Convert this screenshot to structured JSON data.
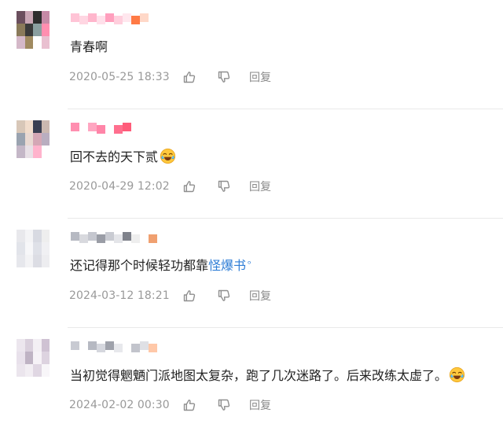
{
  "comments": [
    {
      "text": "青春啊",
      "time": "2020-05-25 18:33",
      "reply_label": "回复",
      "avatar_colors": [
        "#6b4f5e",
        "#c9a6b5",
        "#2d2d2d",
        "#c58aa6",
        "#8a7a5a",
        "#3a3a3a",
        "#8a9fa0",
        "#ff8fb0",
        "#d4b8c8",
        "#a08a60",
        "#ffffff",
        "#e9c0d0"
      ],
      "name_colors": [
        "#ffc4d6",
        "#ffd6e2",
        "#ffb6cc",
        "#ffe0ea",
        "#ff9fbd",
        "#ffcfdd",
        "#ffe7ee",
        "#ff7a45",
        "#ffd8c8"
      ]
    },
    {
      "text": "回不去的天下贰",
      "emoji": "crying-laughing-emoji",
      "time": "2020-04-29 12:02",
      "reply_label": "回复",
      "avatar_colors": [
        "#d8c7b8",
        "#f1dccb",
        "#3a3f52",
        "#cbb8b0",
        "#9aa3b0",
        "#e9d9d2",
        "#d4a7b5",
        "#b9aec0",
        "#c4b7c7",
        "#e8e0e6",
        "#ffb3cc",
        "#ffffff"
      ],
      "name_colors": [
        "#ff8fb0",
        "#ffffff",
        "#ffa6c1",
        "#ff85a8",
        "#ffffff",
        "#ff6f8e",
        "#ff5c7a"
      ]
    },
    {
      "text": "还记得那个时候轻功都靠",
      "link_text": "怪爆书",
      "time": "2024-03-12 18:21",
      "reply_label": "回复",
      "avatar_colors": [
        "#e8e8ec",
        "#f4f4f6",
        "#d8dae2",
        "#eeeeee",
        "#e2e4ea",
        "#f7f7f9",
        "#dfe1e8",
        "#f0f0f3",
        "#e6e7ec",
        "#f3f3f5",
        "#dcdde4",
        "#ededf0"
      ],
      "name_colors": [
        "#b6b9c2",
        "#d8d9de",
        "#c5c7cf",
        "#9a9da6",
        "#c9cbd2",
        "#e4e5e9",
        "#7f828b",
        "#eeeeee",
        "#ffffff",
        "#f0a070"
      ]
    },
    {
      "text": "当初觉得魍魉门派地图太复杂，跑了几次迷路了。后来改练太虚了。",
      "emoji": "crying-laughing-emoji",
      "time": "2024-02-02 00:30",
      "reply_label": "回复",
      "avatar_colors": [
        "#ece6ee",
        "#d9cfdc",
        "#f3eff4",
        "#cfc2d3",
        "#e8e1eb",
        "#bfb3c4",
        "#f6f2f7",
        "#ddd3e0",
        "#ebe5ed",
        "#f2eef3",
        "#e0d7e3",
        "#f8f6f9"
      ],
      "name_colors": [
        "#c8cad2",
        "#ffffff",
        "#b6b9c2",
        "#d5d7de",
        "#9fa2ab",
        "#e7e8ec",
        "#ffffff",
        "#c2c4cc",
        "#dfe0e5",
        "#ffc8a8"
      ]
    }
  ]
}
